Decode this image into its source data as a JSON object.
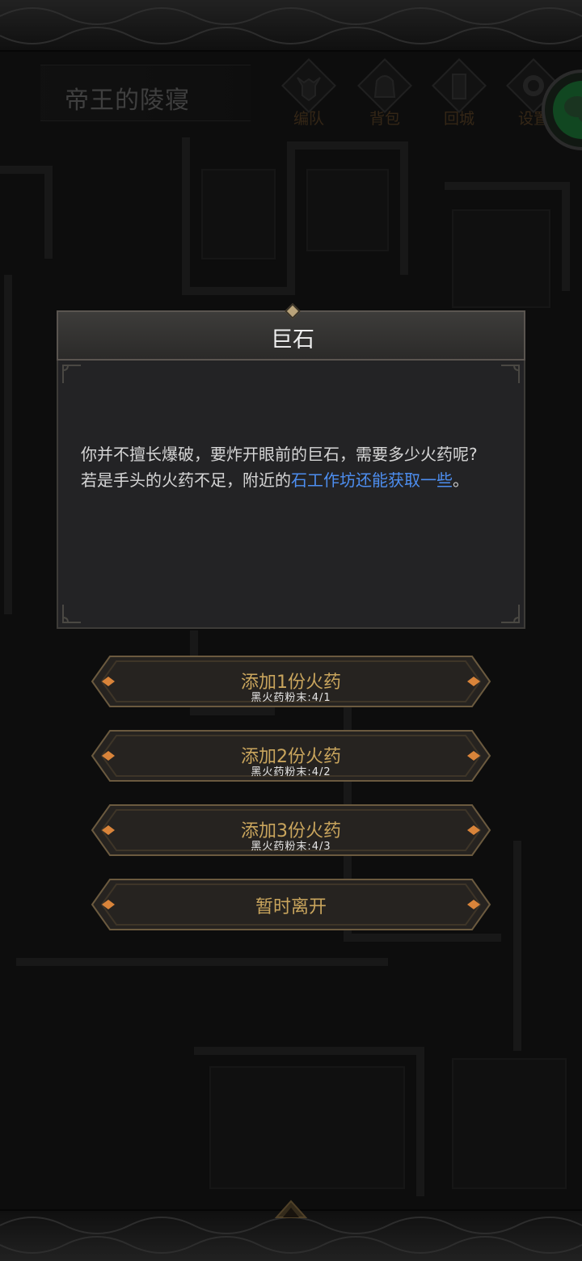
{
  "hud": {
    "area_name": "帝王的陵寝",
    "buttons": [
      {
        "label": "编队",
        "icon": "helmet-icon"
      },
      {
        "label": "背包",
        "icon": "bag-icon"
      },
      {
        "label": "回城",
        "icon": "door-icon"
      },
      {
        "label": "设置",
        "icon": "gear-icon"
      }
    ],
    "floating": {
      "icon": "wechat-icon"
    }
  },
  "dialog": {
    "title": "巨石",
    "text_line1": "你并不擅长爆破，要炸开眼前的巨石，需要多少火药呢?",
    "text_line2_pre": "若是手头的火药不足，附近的",
    "text_line2_link": "石工作坊还能获取一些",
    "text_line2_post": "。"
  },
  "options": [
    {
      "label": "添加1份火药",
      "sub": "黑火药粉末:4/1"
    },
    {
      "label": "添加2份火药",
      "sub": "黑火药粉末:4/2"
    },
    {
      "label": "添加3份火药",
      "sub": "黑火药粉末:4/3"
    },
    {
      "label": "暂时离开",
      "sub": ""
    }
  ],
  "colors": {
    "link": "#4d8ef0",
    "option_text": "#c9a55d",
    "panel_bg": "#232325"
  }
}
